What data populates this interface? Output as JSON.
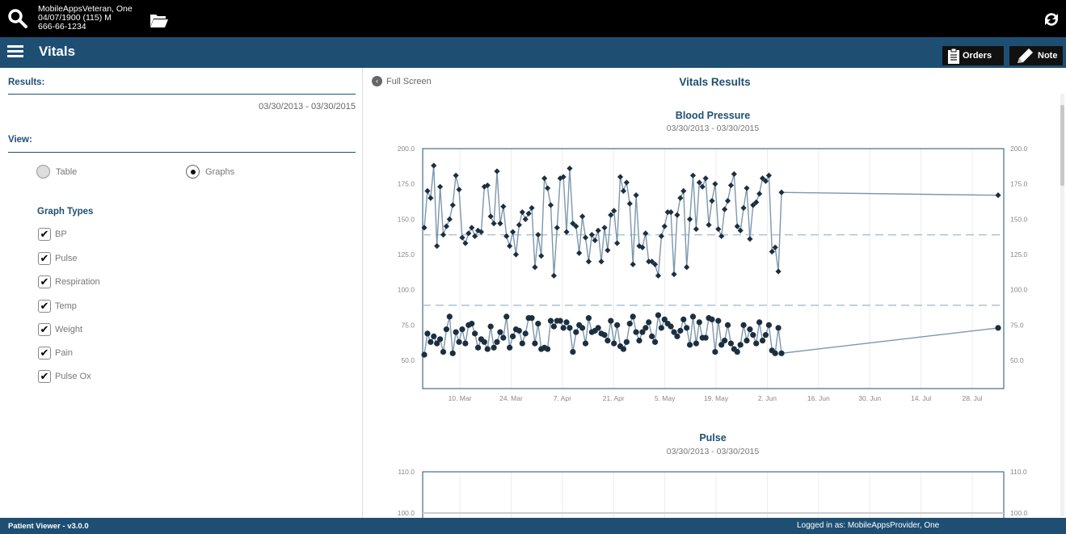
{
  "patient": {
    "name": "MobileAppsVeteran, One",
    "dob_line": "04/07/1900 (115) M",
    "ssn": "666-66-1234"
  },
  "header": {
    "title": "Vitals",
    "orders_label": "Orders",
    "note_label": "Note"
  },
  "left": {
    "results_label": "Results:",
    "date_range": "03/30/2013 - 03/30/2015",
    "view_label": "View:",
    "view_options": [
      {
        "label": "Table",
        "selected": false
      },
      {
        "label": "Graphs",
        "selected": true
      }
    ],
    "graph_types_label": "Graph Types",
    "graph_types": [
      {
        "label": "BP",
        "checked": true
      },
      {
        "label": "Pulse",
        "checked": true
      },
      {
        "label": "Respiration",
        "checked": true
      },
      {
        "label": "Temp",
        "checked": true
      },
      {
        "label": "Weight",
        "checked": true
      },
      {
        "label": "Pain",
        "checked": true
      },
      {
        "label": "Pulse Ox",
        "checked": true
      }
    ]
  },
  "right": {
    "full_screen_label": "Full Screen",
    "title": "Vitals Results"
  },
  "footer": {
    "version": "Patient Viewer - v3.0.0",
    "logged_in": "Logged in as: MobileAppsProvider, One"
  },
  "colors": {
    "header_blue": "#1e4f73",
    "line_color": "#7d97ab",
    "marker_color": "#1c2f40",
    "ref_line": "#a9c3d2"
  },
  "chart_data": [
    {
      "type": "line",
      "title": "Blood Pressure",
      "subtitle": "03/30/2013 - 03/30/2015",
      "ylim": [
        30,
        200
      ],
      "y_ticks": [
        "200.0",
        "175.0",
        "150.0",
        "125.0",
        "100.0",
        "75.0",
        "50.0"
      ],
      "x_ticks": [
        "10. Mar",
        "24. Mar",
        "7. Apr",
        "21. Apr",
        "5. May",
        "19. May",
        "2. Jun",
        "16. Jun",
        "30. Jun",
        "14. Jul",
        "28. Jul"
      ],
      "reference_lines": [
        139,
        89
      ],
      "series": [
        {
          "marker": "diamond",
          "values": [
            144,
            170,
            165,
            188,
            131,
            173,
            139,
            145,
            150,
            160,
            181,
            171,
            137,
            133,
            140,
            144,
            138,
            142,
            141,
            173,
            174,
            152,
            147,
            184,
            147,
            159,
            138,
            131,
            141,
            125,
            146,
            155,
            150,
            154,
            158,
            116,
            139,
            124,
            179,
            172,
            160,
            110,
            144,
            179,
            180,
            141,
            186,
            147,
            145,
            126,
            152,
            137,
            120,
            139,
            135,
            142,
            120,
            144,
            128,
            153,
            156,
            133,
            180,
            170,
            176,
            161,
            118,
            167,
            131,
            130,
            140,
            120,
            120,
            118,
            110,
            138,
            145,
            155,
            155,
            111,
            153,
            165,
            170,
            116,
            150,
            181,
            143,
            176,
            173,
            179,
            146,
            163,
            175,
            143,
            138,
            157,
            163,
            174,
            182,
            145,
            142,
            158,
            172,
            136,
            160,
            162,
            168,
            179,
            177,
            181,
            127,
            130,
            113,
            169,
            167
          ]
        },
        {
          "marker": "circle",
          "values": [
            54,
            69,
            63,
            67,
            62,
            65,
            56,
            72,
            81,
            55,
            70,
            63,
            72,
            62,
            75,
            76,
            69,
            59,
            65,
            63,
            58,
            74,
            59,
            63,
            70,
            66,
            81,
            59,
            67,
            72,
            71,
            62,
            69,
            80,
            80,
            62,
            76,
            58,
            59,
            58,
            78,
            74,
            78,
            78,
            73,
            77,
            73,
            56,
            70,
            75,
            73,
            62,
            80,
            70,
            71,
            73,
            69,
            68,
            64,
            78,
            62,
            75,
            60,
            58,
            63,
            76,
            81,
            70,
            64,
            70,
            73,
            77,
            67,
            63,
            82,
            73,
            79,
            76,
            74,
            70,
            67,
            71,
            79,
            73,
            61,
            81,
            62,
            77,
            66,
            66,
            80,
            79,
            56,
            78,
            61,
            64,
            75,
            62,
            58,
            56,
            61,
            75,
            64,
            72,
            68,
            62,
            77,
            64,
            68,
            75,
            57,
            55,
            73,
            55,
            73
          ]
        }
      ]
    },
    {
      "type": "line",
      "title": "Pulse",
      "subtitle": "03/30/2013 - 03/30/2015",
      "y_ticks": [
        "110.0",
        "100.0"
      ]
    }
  ]
}
